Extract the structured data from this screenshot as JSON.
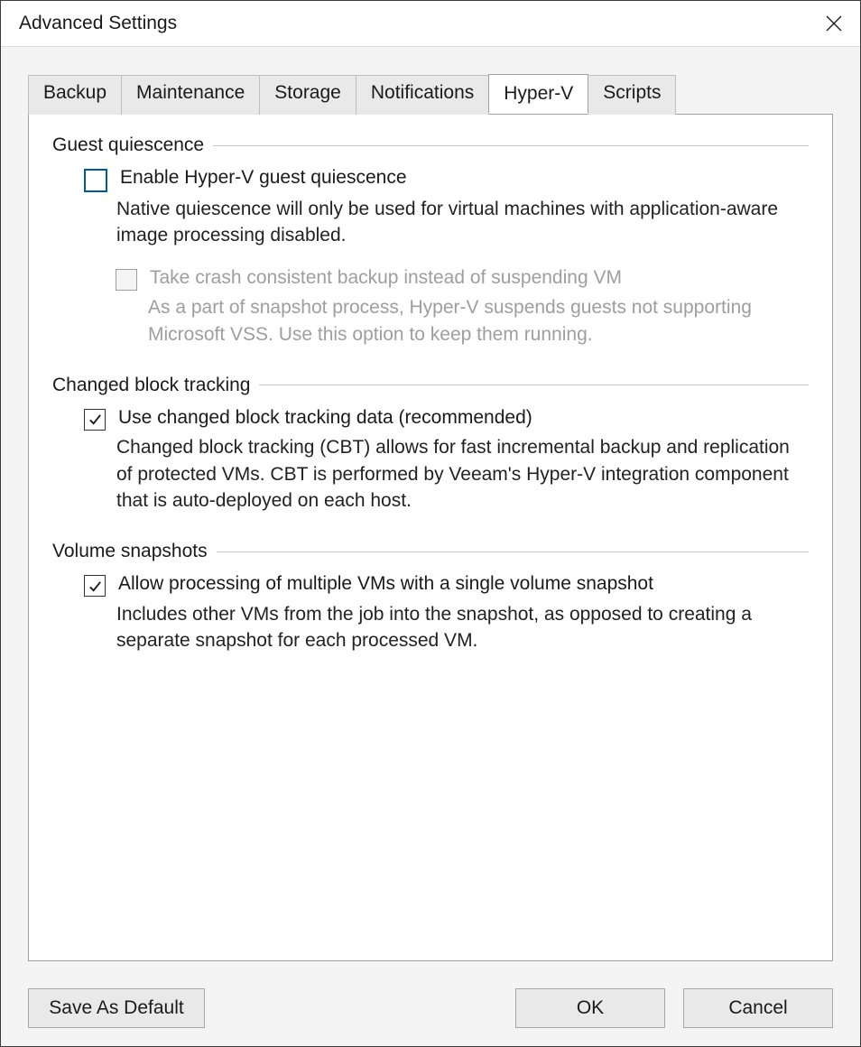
{
  "window": {
    "title": "Advanced Settings"
  },
  "tabs": [
    {
      "label": "Backup",
      "active": false
    },
    {
      "label": "Maintenance",
      "active": false
    },
    {
      "label": "Storage",
      "active": false
    },
    {
      "label": "Notifications",
      "active": false
    },
    {
      "label": "Hyper-V",
      "active": true
    },
    {
      "label": "Scripts",
      "active": false
    }
  ],
  "groups": {
    "quiescence": {
      "title": "Guest quiescence",
      "enable": {
        "label": "Enable Hyper-V guest quiescence",
        "checked": false,
        "desc": "Native quiescence will only be used for virtual machines with application-aware image processing disabled."
      },
      "crash": {
        "label": "Take crash consistent backup instead of suspending VM",
        "checked": false,
        "enabled": false,
        "desc": "As a part of snapshot process, Hyper-V suspends guests not supporting Microsoft VSS. Use this option to keep them running."
      }
    },
    "cbt": {
      "title": "Changed block tracking",
      "use": {
        "label": "Use changed block tracking data (recommended)",
        "checked": true,
        "desc": "Changed block tracking (CBT) allows for fast incremental backup and replication of protected VMs. CBT is performed by Veeam's Hyper-V integration component that is auto-deployed on each host."
      }
    },
    "snap": {
      "title": "Volume snapshots",
      "allow": {
        "label": "Allow processing of multiple VMs with a single volume snapshot",
        "checked": true,
        "desc": "Includes other VMs from the job into the snapshot, as opposed to creating a separate snapshot for each processed VM."
      }
    }
  },
  "buttons": {
    "saveDefault": "Save As Default",
    "ok": "OK",
    "cancel": "Cancel"
  }
}
